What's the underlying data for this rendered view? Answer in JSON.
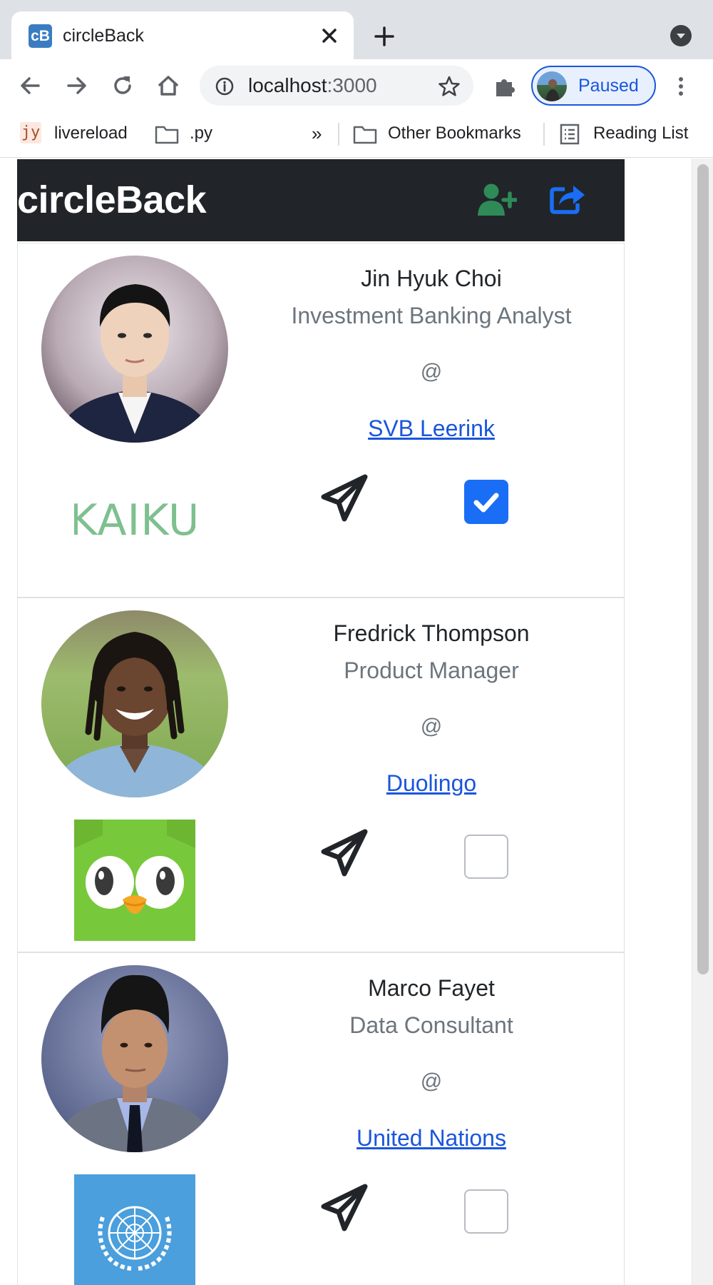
{
  "browser": {
    "tab_title": "circleBack",
    "favicon_text": "cB",
    "url_host": "localhost",
    "url_port": ":3000",
    "profile_status": "Paused",
    "bookmarks": [
      {
        "label": "livereload",
        "icon": "jy-favicon"
      },
      {
        "label": ".py",
        "icon": "folder-icon"
      },
      {
        "label": "Other Bookmarks",
        "icon": "folder-icon"
      },
      {
        "label": "Reading List",
        "icon": "reading-list-icon"
      }
    ],
    "bookmarks_overflow": "»",
    "jy_text": "jy"
  },
  "app": {
    "brand": "circleBack",
    "icons": {
      "add_contact": "user-plus-icon",
      "share": "share-icon"
    },
    "colors": {
      "navbar": "#212529",
      "add_icon": "#2e8b57",
      "share_icon": "#1a6ef5",
      "link": "#1a56db",
      "checkbox_checked": "#1a6ef5"
    }
  },
  "contacts": [
    {
      "name": "Jin Hyuk Choi",
      "title": "Investment Banking Analyst",
      "at": "@",
      "company": "SVB Leerink",
      "logo_text": "KAIKU",
      "checked": true
    },
    {
      "name": "Fredrick Thompson",
      "title": "Product Manager",
      "at": "@",
      "company": "Duolingo",
      "logo_text": "",
      "checked": false
    },
    {
      "name": "Marco Fayet",
      "title": "Data Consultant",
      "at": "@",
      "company": "United Nations",
      "logo_text": "",
      "checked": false
    }
  ]
}
